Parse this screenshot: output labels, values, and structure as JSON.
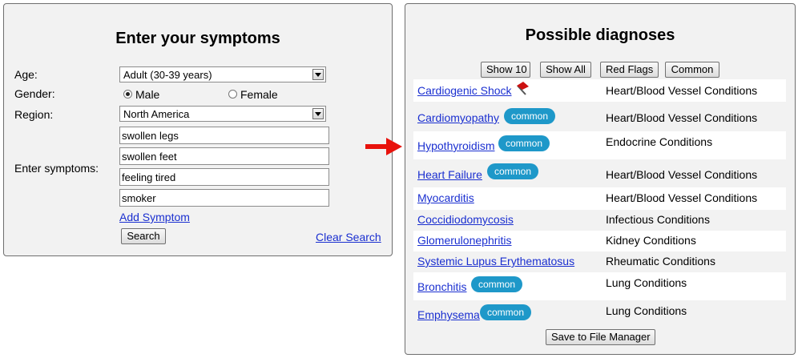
{
  "left": {
    "title": "Enter your symptoms",
    "age_label": "Age:",
    "age_value": "Adult (30-39 years)",
    "gender_label": "Gender:",
    "gender_options": [
      {
        "label": "Male",
        "selected": true
      },
      {
        "label": "Female",
        "selected": false
      }
    ],
    "region_label": "Region:",
    "region_value": "North America",
    "symptoms_label": "Enter symptoms:",
    "symptoms": [
      "swollen legs",
      "swollen feet",
      "feeling tired",
      "smoker"
    ],
    "add_symptom": "Add Symptom",
    "search_button": "Search",
    "clear_search": "Clear Search"
  },
  "right": {
    "title": "Possible diagnoses",
    "filters": [
      "Show 10",
      "Show All",
      "Red Flags",
      "Common"
    ],
    "diagnoses": [
      {
        "name": "Cardiogenic Shock",
        "category": "Heart/Blood Vessel Conditions",
        "badge": "",
        "red_flag": true
      },
      {
        "name": "Cardiomyopathy",
        "category": "Heart/Blood Vessel Conditions",
        "badge": "common",
        "red_flag": false
      },
      {
        "name": "Hypothyroidism",
        "category": "Endocrine Conditions",
        "badge": "common",
        "red_flag": false
      },
      {
        "name": "Heart Failure",
        "category": "Heart/Blood Vessel Conditions",
        "badge": "common",
        "red_flag": false
      },
      {
        "name": "Myocarditis",
        "category": "Heart/Blood Vessel Conditions",
        "badge": "",
        "red_flag": false
      },
      {
        "name": "Coccidiodomycosis",
        "category": "Infectious Conditions",
        "badge": "",
        "red_flag": false
      },
      {
        "name": "Glomerulonephritis",
        "category": "Kidney Conditions",
        "badge": "",
        "red_flag": false
      },
      {
        "name": "Systemic Lupus Erythematosus",
        "category": "Rheumatic Conditions",
        "badge": "",
        "red_flag": false
      },
      {
        "name": "Bronchitis",
        "category": "Lung Conditions",
        "badge": "common",
        "red_flag": false
      },
      {
        "name": "Emphysema",
        "category": "Lung Conditions",
        "badge": "common",
        "red_flag": false
      }
    ],
    "save_button": "Save to File Manager"
  },
  "colors": {
    "panel_bg": "#f2f2f2",
    "link": "#1a2fd0",
    "badge": "#1e98c9",
    "arrow": "#e8120c",
    "red_flag": "#cc1111"
  },
  "icons": {
    "arrow": "right-arrow-icon",
    "red_flag": "red-flag-icon",
    "dropdown": "chevron-down-icon"
  }
}
